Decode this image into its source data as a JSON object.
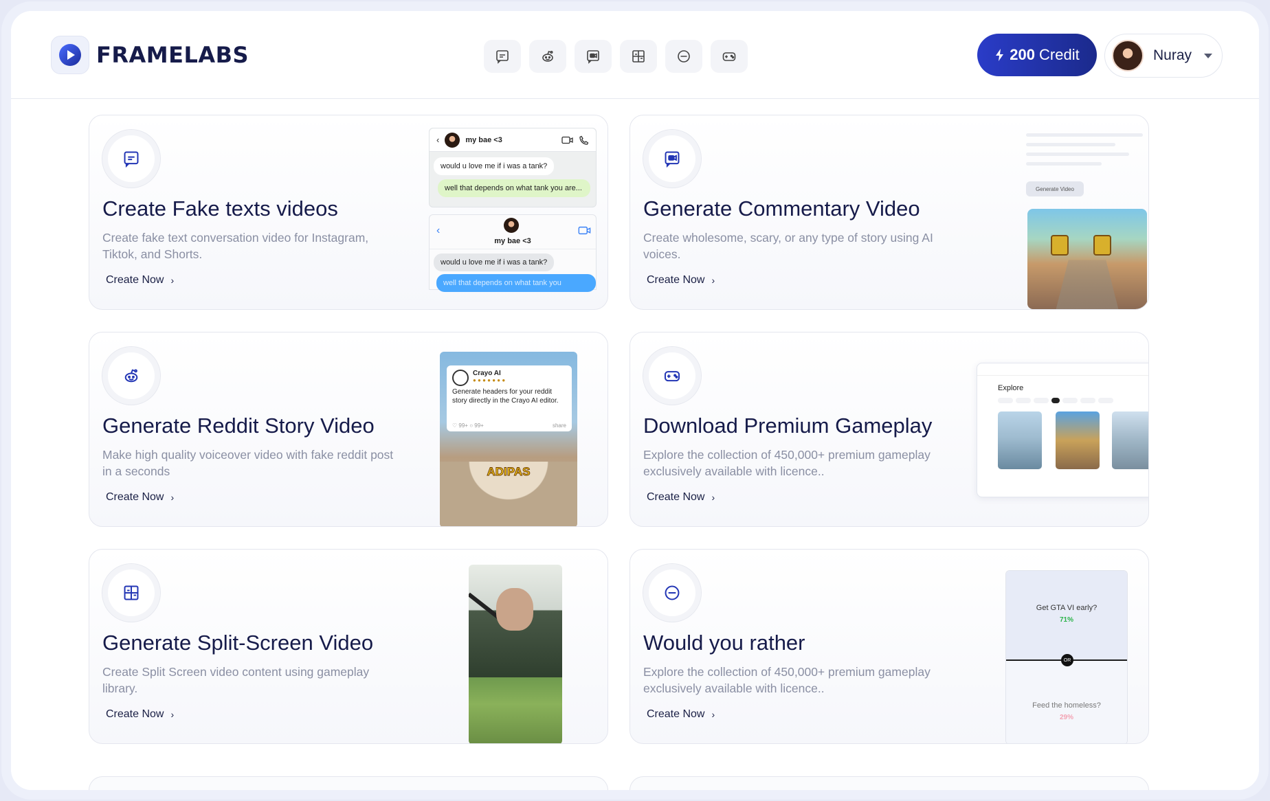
{
  "brand": {
    "name": "FRAMELABS"
  },
  "nav": {
    "icons": [
      "chat-square-icon",
      "reddit-icon",
      "video-message-icon",
      "split-layout-icon",
      "minus-circle-icon",
      "gamepad-icon"
    ]
  },
  "credit": {
    "amount": "200",
    "label": "Credit"
  },
  "user": {
    "name": "Nuray"
  },
  "cta_label": "Create Now",
  "cards": [
    {
      "title": "Create Fake texts videos",
      "desc": "Create fake text conversation video for Instagram, Tiktok, and Shorts.",
      "preview": {
        "contact": "my bae <3",
        "msg1": "would u love me if i was a tank?",
        "msg2": "well that depends on what tank you are...",
        "msg3": "would u love me if i was a tank?",
        "msg4": "well that depends on what tank you"
      }
    },
    {
      "title": "Generate Commentary Video",
      "desc": "Create wholesome, scary, or any type of story using AI voices.",
      "preview": {
        "chip": "Generate Video"
      }
    },
    {
      "title": "Generate Reddit Story Video",
      "desc": "Make high quality voiceover video with fake reddit post in a seconds",
      "preview": {
        "author": "Crayo AI",
        "text": "Generate headers for your reddit story directly in the Crayo AI editor.",
        "likes": "99+",
        "comments": "99+",
        "share": "share",
        "overlay": "ADIPAS"
      }
    },
    {
      "title": "Download Premium Gameplay",
      "desc": "Explore the collection of 450,000+ premium gameplay exclusively available with licence..",
      "preview": {
        "heading": "Explore"
      }
    },
    {
      "title": "Generate Split-Screen Video",
      "desc": "Create Split Screen video content using gameplay library."
    },
    {
      "title": "Would you rather",
      "desc": "Explore the collection of 450,000+ premium gameplay exclusively available with licence..",
      "preview": {
        "q1": "Get GTA VI early?",
        "p1": "71%",
        "or": "OR",
        "q2": "Feed the homeless?",
        "p2": "29%"
      }
    }
  ],
  "colors": {
    "accent": "#2a3cc8",
    "icon": "#2336b5",
    "title": "#161b4a",
    "muted": "#8a8fa3"
  }
}
